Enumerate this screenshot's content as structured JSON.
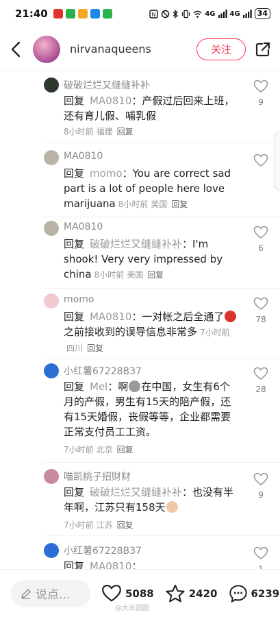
{
  "status_bar": {
    "time": "21:40",
    "network_1": "4G",
    "network_2": "4G",
    "battery": "34",
    "app_colors": [
      "#e0342e",
      "#2bb24c",
      "#f5a623",
      "#1e88e5",
      "#2bb24c"
    ]
  },
  "header": {
    "username": "nirvanaqueens",
    "follow_label": "关注"
  },
  "comments": [
    {
      "name": "破破烂烂又缝缝补补",
      "avatar_color": "#2f3a2f",
      "prefix": "回复",
      "target": "MA0810",
      "text": "：产假过后回来上班，还有育儿假、哺乳假",
      "time": "8小时前",
      "location": "福建",
      "reply": "回复",
      "likes": "9"
    },
    {
      "name": "MA0810",
      "avatar_color": "#b9b2a6",
      "prefix": "回复",
      "target": "momo",
      "text": "：You are correct sad part is a lot of people here love marijuana",
      "time": "8小时前",
      "location": "美国",
      "reply": "回复",
      "likes": ""
    },
    {
      "name": "MA0810",
      "avatar_color": "#b9b2a6",
      "prefix": "回复",
      "target": "破破烂烂又缝缝补补",
      "text": "：I'm shook! Very very impressed by china",
      "time": "8小时前",
      "location": "美国",
      "reply": "回复",
      "likes": "6"
    },
    {
      "name": "momo",
      "avatar_color": "#f3c9cf",
      "prefix": "回复",
      "target": "MA0810",
      "text_a": "：一对帐之后全通了",
      "text_b": "之前接收到的误导信息非常多",
      "emoji_color": "#d9342b",
      "time": "7小时前",
      "location": "四川",
      "reply": "回复",
      "likes": "78"
    },
    {
      "name": "小红薯67228B37",
      "avatar_color": "#2b6fd6",
      "prefix": "回复",
      "target": "Mel",
      "text_a": "：啊",
      "text_b": "在中国，女生有6个月的产假，男生有15天的陪产假，还有15天婚假，丧假等等，企业都需要正常支付员工工资。",
      "emoji_color": "#9a9a9a",
      "time": "7小时前",
      "location": "北京",
      "reply": "回复",
      "likes": "28"
    },
    {
      "name": "喵凯桃子招财财",
      "avatar_color": "#c98a9e",
      "prefix": "回复",
      "target": "破破烂烂又缝缝补补",
      "text_a": "：也没有半年啊，江苏只有158天",
      "emoji_color": "#f0c9a6",
      "time": "7小时前",
      "location": "江苏",
      "reply": "回复",
      "likes": "9"
    },
    {
      "name": "小红薯67228B37",
      "avatar_color": "#2b6fd6",
      "prefix": "回复",
      "target": "MA0810",
      "text": "：",
      "likes": "1"
    }
  ],
  "bottom_bar": {
    "input_placeholder": "说点…",
    "likes": "5088",
    "stars": "2420",
    "comments": "6239"
  },
  "watermark": "@大米圆圆"
}
